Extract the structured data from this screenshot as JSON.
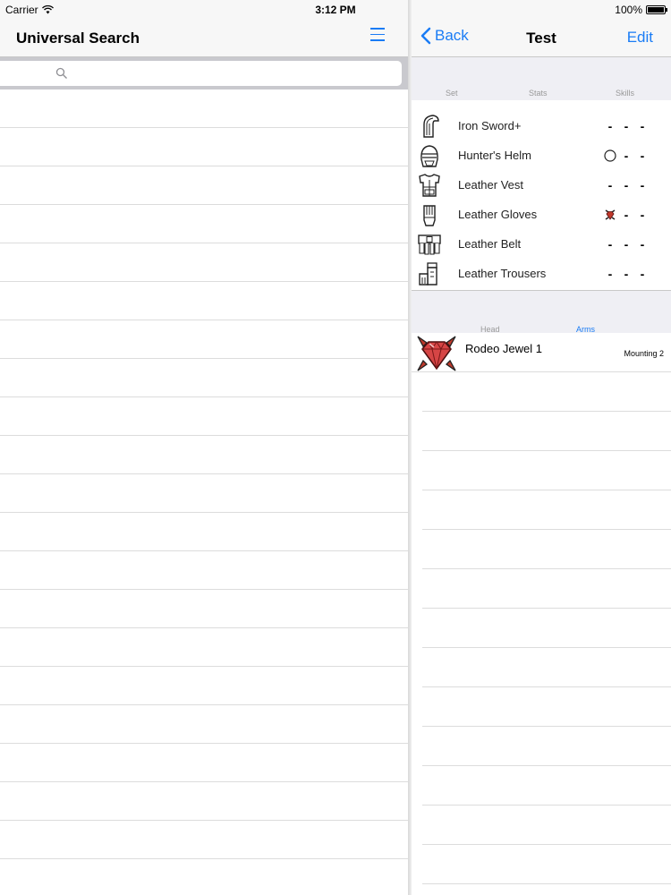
{
  "status_bar": {
    "carrier": "Carrier",
    "time": "3:12 PM",
    "battery": "100%"
  },
  "left_pane": {
    "title": "Universal Search",
    "search": {
      "placeholder": ""
    },
    "empty_rows": 21
  },
  "right_pane": {
    "nav": {
      "back_label": "Back",
      "title": "Test",
      "edit_label": "Edit"
    },
    "segments": [
      "Set",
      "Stats",
      "Skills"
    ],
    "equipment": [
      {
        "name": "Iron Sword+",
        "icon": "sword-icon",
        "slots": [
          "-",
          "-",
          "-"
        ]
      },
      {
        "name": "Hunter's Helm",
        "icon": "helm-icon",
        "slots": [
          "circle",
          "-",
          "-"
        ]
      },
      {
        "name": "Leather Vest",
        "icon": "vest-icon",
        "slots": [
          "-",
          "-",
          "-"
        ]
      },
      {
        "name": "Leather Gloves",
        "icon": "gloves-icon",
        "slots": [
          "jewel",
          "-",
          "-"
        ]
      },
      {
        "name": "Leather Belt",
        "icon": "belt-icon",
        "slots": [
          "-",
          "-",
          "-"
        ]
      },
      {
        "name": "Leather Trousers",
        "icon": "trousers-icon",
        "slots": [
          "-",
          "-",
          "-"
        ]
      }
    ],
    "tabs": [
      {
        "label": "Head",
        "active": false
      },
      {
        "label": "Arms",
        "active": true
      }
    ],
    "jewel": {
      "name": "Rodeo Jewel 1",
      "mounting": "Mounting 2",
      "icon": "jewel-icon"
    }
  },
  "colors": {
    "accent": "#1a7cf5",
    "jewel": "#c0392b"
  }
}
